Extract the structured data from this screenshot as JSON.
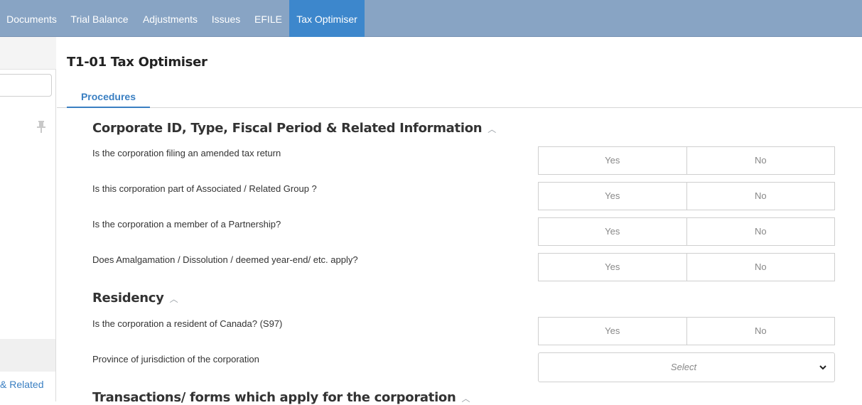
{
  "nav": {
    "tabs": [
      {
        "label": "Documents"
      },
      {
        "label": "Trial Balance"
      },
      {
        "label": "Adjustments"
      },
      {
        "label": "Issues"
      },
      {
        "label": "EFILE"
      },
      {
        "label": "Tax Optimiser"
      }
    ],
    "active_tab": "Tax Optimiser",
    "active_color": "#3d87cc",
    "bar_color": "#88a4c4"
  },
  "sidebar": {
    "link_text": "& Related",
    "pin_icon": "pin-icon"
  },
  "page": {
    "title": "T1-01 Tax Optimiser",
    "tab": "Procedures"
  },
  "sections": [
    {
      "title": "Corporate ID, Type, Fiscal Period & Related Information",
      "questions": [
        {
          "text": "Is the corporation filing an amended tax return",
          "yes": "Yes",
          "no": "No"
        },
        {
          "text": "Is this corporation part of Associated / Related Group ?",
          "yes": "Yes",
          "no": "No"
        },
        {
          "text": "Is the corporation a member of a Partnership?",
          "yes": "Yes",
          "no": "No"
        },
        {
          "text": "Does Amalgamation / Dissolution / deemed year-end/ etc. apply?",
          "yes": "Yes",
          "no": "No"
        }
      ]
    },
    {
      "title": "Residency",
      "questions": [
        {
          "text": "Is the corporation a resident of Canada? (S97)",
          "yes": "Yes",
          "no": "No"
        },
        {
          "text": "Province of jurisdiction of the corporation",
          "select_placeholder": "Select"
        }
      ]
    },
    {
      "title": "Transactions/ forms which apply for the corporation"
    }
  ]
}
